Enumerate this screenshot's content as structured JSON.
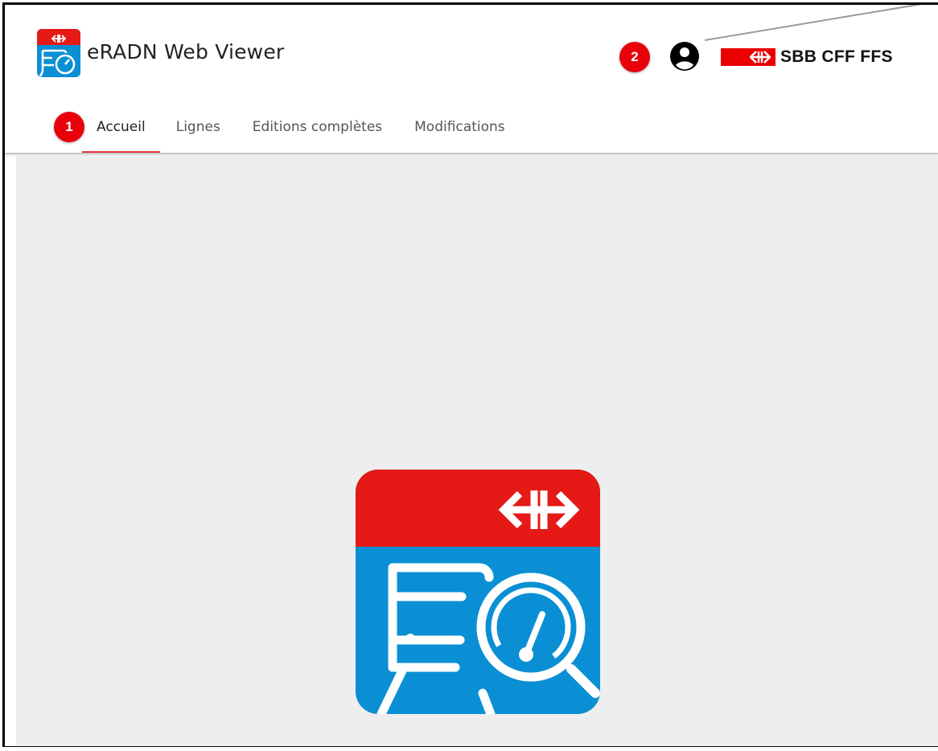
{
  "header": {
    "app_title": "eRADN Web Viewer",
    "brand_text": "SBB CFF FFS",
    "app_logo_icon": "eradn-app-icon",
    "user_icon": "account-circle-icon"
  },
  "callouts": {
    "one": "1",
    "two": "2"
  },
  "tabs": [
    {
      "label": "Accueil",
      "active": true
    },
    {
      "label": "Lignes",
      "active": false
    },
    {
      "label": "Editions complètes",
      "active": false
    },
    {
      "label": "Modifications",
      "active": false
    }
  ],
  "colors": {
    "brand_red": "#eb0000",
    "app_blue": "#0a8fd4",
    "tab_indicator": "#e8363c",
    "content_bg": "#eeeeee"
  }
}
